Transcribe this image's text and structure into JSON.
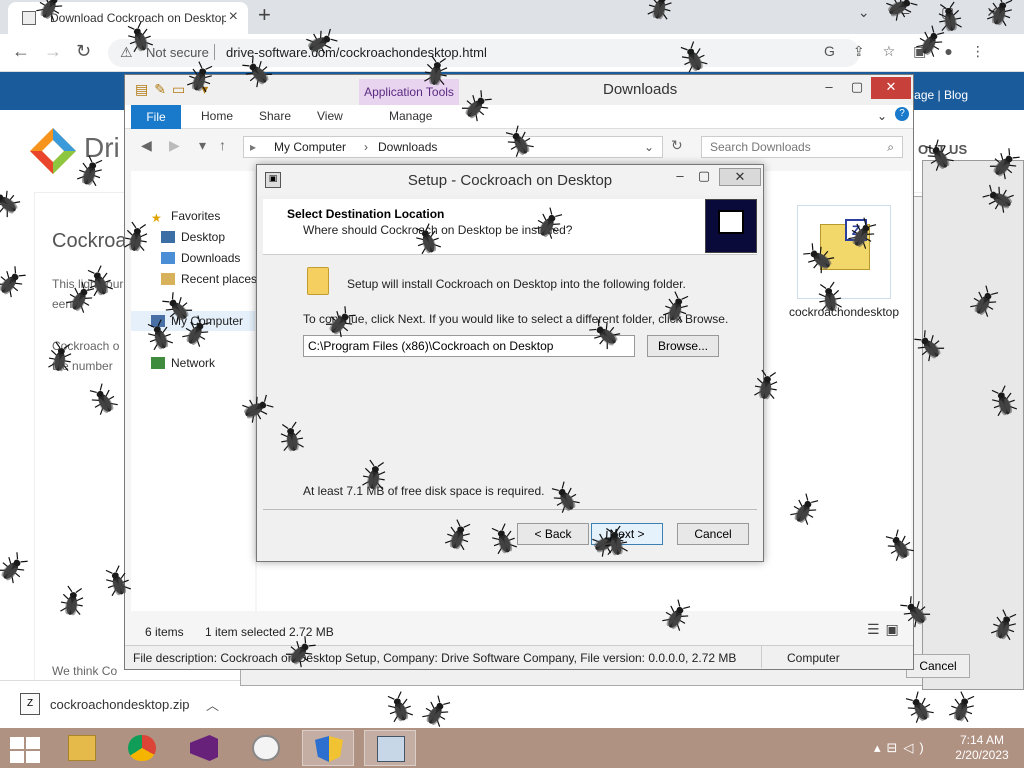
{
  "browser": {
    "tab_title": "Download Cockroach on Desktop",
    "tab_controls": "⌄ – ▢ ✕",
    "not_secure": "Not secure",
    "url": "drive-software.com/cockroachondesktop.html",
    "page_links": "age | Blog",
    "brand": "Dri",
    "about_us": "OUT US",
    "page_title": "Cockroa",
    "page_text_1": "This ligh your een.",
    "page_text_2": "Cockroach o the number",
    "page_text_3": "We think Co",
    "download_file": "cockroachondesktop.zip",
    "bg_cancel": "Cancel"
  },
  "explorer": {
    "app_tools": "Application Tools",
    "title": "Downloads",
    "ribbon_tabs": [
      "File",
      "Home",
      "Share",
      "View",
      "Manage"
    ],
    "breadcrumb_1": "My Computer",
    "breadcrumb_2": "Downloads",
    "search_placeholder": "Search Downloads",
    "nav": {
      "favorites": "Favorites",
      "desktop": "Desktop",
      "downloads": "Downloads",
      "recent": "Recent places",
      "computer": "My Computer",
      "network": "Network"
    },
    "file_name": "cockroachondesktop",
    "status_items": "6 items",
    "status_selected": "1 item selected  2.72 MB",
    "description": "File description: Cockroach on Desktop Setup, Company: Drive Software Company, File version: 0.0.0.0,  2.72 MB",
    "computer": "Computer"
  },
  "setup": {
    "title": "Setup - Cockroach on Desktop",
    "heading": "Select Destination Location",
    "subheading": "Where should Cockroach on Desktop be installed?",
    "install_text": "Setup will install Cockroach on Desktop into the following folder.",
    "continue_text": "To continue, click Next. If you would like to select a different folder, click Browse.",
    "path": "C:\\Program Files (x86)\\Cockroach on Desktop",
    "browse": "Browse...",
    "disk_space": "At least 7.1 MB of free disk space is required.",
    "back": "< Back",
    "next": "Next >",
    "cancel": "Cancel"
  },
  "taskbar": {
    "time": "7:14 AM",
    "date": "2/20/2023"
  },
  "colors": {
    "taskbar": "#b09283",
    "ribbon_file": "#1979ca",
    "app_tools": "#e9d4f0",
    "site_bar": "#1a5b9c"
  }
}
